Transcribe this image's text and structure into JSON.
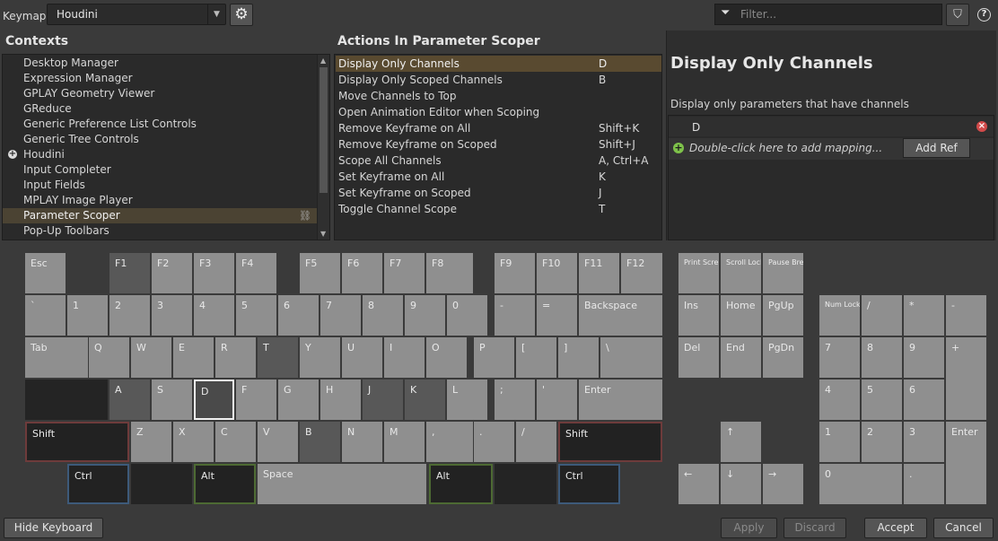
{
  "header": {
    "keymap_label": "Keymap",
    "keymap_value": "Houdini",
    "filter_placeholder": "Filter...",
    "help_label": "?"
  },
  "contexts": {
    "title": "Contexts",
    "items": [
      {
        "label": "Desktop Manager"
      },
      {
        "label": "Expression Manager"
      },
      {
        "label": "GPLAY Geometry Viewer"
      },
      {
        "label": "GReduce"
      },
      {
        "label": "Generic Preference List Controls"
      },
      {
        "label": "Generic Tree Controls"
      },
      {
        "label": "Houdini",
        "expandable": true
      },
      {
        "label": "Input Completer"
      },
      {
        "label": "Input Fields"
      },
      {
        "label": "MPLAY Image Player"
      },
      {
        "label": "Parameter Scoper",
        "selected": true
      },
      {
        "label": "Pop-Up Toolbars"
      }
    ]
  },
  "actions": {
    "title": "Actions In Parameter Scoper",
    "items": [
      {
        "name": "Display Only Channels",
        "keys": "D",
        "selected": true
      },
      {
        "name": "Display Only Scoped Channels",
        "keys": "B"
      },
      {
        "name": "Move Channels to Top",
        "keys": ""
      },
      {
        "name": "Open Animation Editor when Scoping",
        "keys": ""
      },
      {
        "name": "Remove Keyframe on All",
        "keys": "Shift+K"
      },
      {
        "name": "Remove Keyframe on Scoped",
        "keys": "Shift+J"
      },
      {
        "name": "Scope All Channels",
        "keys": "A, Ctrl+A"
      },
      {
        "name": "Set Keyframe on All",
        "keys": "K"
      },
      {
        "name": "Set Keyframe on Scoped",
        "keys": "J"
      },
      {
        "name": "Toggle Channel Scope",
        "keys": "T"
      }
    ]
  },
  "details": {
    "title": "Display Only Channels",
    "description": "Display only parameters that have channels",
    "mapping": "D",
    "add_hint": "Double-click here to add mapping...",
    "add_ref_label": "Add Ref"
  },
  "keyboard": {
    "main": [
      {
        "label": "Esc"
      },
      {
        "label": "F1",
        "style": "dk"
      },
      {
        "label": "F2"
      },
      {
        "label": "F3"
      },
      {
        "label": "F4"
      },
      {
        "label": "F5"
      },
      {
        "label": "F6"
      },
      {
        "label": "F7"
      },
      {
        "label": "F8"
      },
      {
        "label": "F9"
      },
      {
        "label": "F10"
      },
      {
        "label": "F11"
      },
      {
        "label": "F12"
      },
      {
        "label": "`"
      },
      {
        "label": "1"
      },
      {
        "label": "2"
      },
      {
        "label": "3"
      },
      {
        "label": "4"
      },
      {
        "label": "5"
      },
      {
        "label": "6"
      },
      {
        "label": "7"
      },
      {
        "label": "8"
      },
      {
        "label": "9"
      },
      {
        "label": "0"
      },
      {
        "label": "-"
      },
      {
        "label": "="
      },
      {
        "label": "Backspace"
      },
      {
        "label": "Tab"
      },
      {
        "label": "Q"
      },
      {
        "label": "W"
      },
      {
        "label": "E"
      },
      {
        "label": "R"
      },
      {
        "label": "T",
        "style": "dk"
      },
      {
        "label": "Y"
      },
      {
        "label": "U"
      },
      {
        "label": "I"
      },
      {
        "label": "O"
      },
      {
        "label": "P"
      },
      {
        "label": "["
      },
      {
        "label": "]"
      },
      {
        "label": "\\"
      },
      {
        "label": "",
        "style": "dd"
      },
      {
        "label": "A",
        "style": "dk"
      },
      {
        "label": "S"
      },
      {
        "label": "D",
        "style": "selw"
      },
      {
        "label": "F"
      },
      {
        "label": "G"
      },
      {
        "label": "H"
      },
      {
        "label": "J",
        "style": "dk"
      },
      {
        "label": "K",
        "style": "dk"
      },
      {
        "label": "L"
      },
      {
        "label": ";"
      },
      {
        "label": "'"
      },
      {
        "label": "Enter"
      },
      {
        "label": "Shift",
        "style": "red"
      },
      {
        "label": "Z"
      },
      {
        "label": "X"
      },
      {
        "label": "C"
      },
      {
        "label": "V"
      },
      {
        "label": "B",
        "style": "dk"
      },
      {
        "label": "N"
      },
      {
        "label": "M"
      },
      {
        "label": ","
      },
      {
        "label": "."
      },
      {
        "label": "/"
      },
      {
        "label": "Shift",
        "style": "red"
      },
      {
        "label": "Ctrl",
        "style": "blu"
      },
      {
        "label": "",
        "style": "dd"
      },
      {
        "label": "Alt",
        "style": "grn"
      },
      {
        "label": "Space"
      },
      {
        "label": "Alt",
        "style": "grn"
      },
      {
        "label": "",
        "style": "dd"
      },
      {
        "label": "Ctrl",
        "style": "blu"
      }
    ],
    "nav": [
      {
        "label": "Print Screen"
      },
      {
        "label": "Scroll Lock"
      },
      {
        "label": "Pause Break"
      },
      {
        "label": "Ins"
      },
      {
        "label": "Home"
      },
      {
        "label": "PgUp"
      },
      {
        "label": "Del"
      },
      {
        "label": "End"
      },
      {
        "label": "PgDn"
      },
      {
        "label": "↑"
      },
      {
        "label": "←"
      },
      {
        "label": "↓"
      },
      {
        "label": "→"
      }
    ],
    "numpad": [
      {
        "label": "Num Lock"
      },
      {
        "label": "/"
      },
      {
        "label": "*"
      },
      {
        "label": "-"
      },
      {
        "label": "7"
      },
      {
        "label": "8"
      },
      {
        "label": "9"
      },
      {
        "label": "+"
      },
      {
        "label": "4"
      },
      {
        "label": "5"
      },
      {
        "label": "6"
      },
      {
        "label": "1"
      },
      {
        "label": "2"
      },
      {
        "label": "3"
      },
      {
        "label": "Enter"
      },
      {
        "label": "0"
      },
      {
        "label": "."
      }
    ]
  },
  "footer": {
    "hide_keyboard": "Hide Keyboard",
    "apply": "Apply",
    "discard": "Discard",
    "accept": "Accept",
    "cancel": "Cancel"
  },
  "colors": {
    "selection": "#594a30",
    "shift_outline": "#6e3b3b",
    "ctrl_outline": "#3d5a7a",
    "alt_outline": "#4d6a33"
  }
}
